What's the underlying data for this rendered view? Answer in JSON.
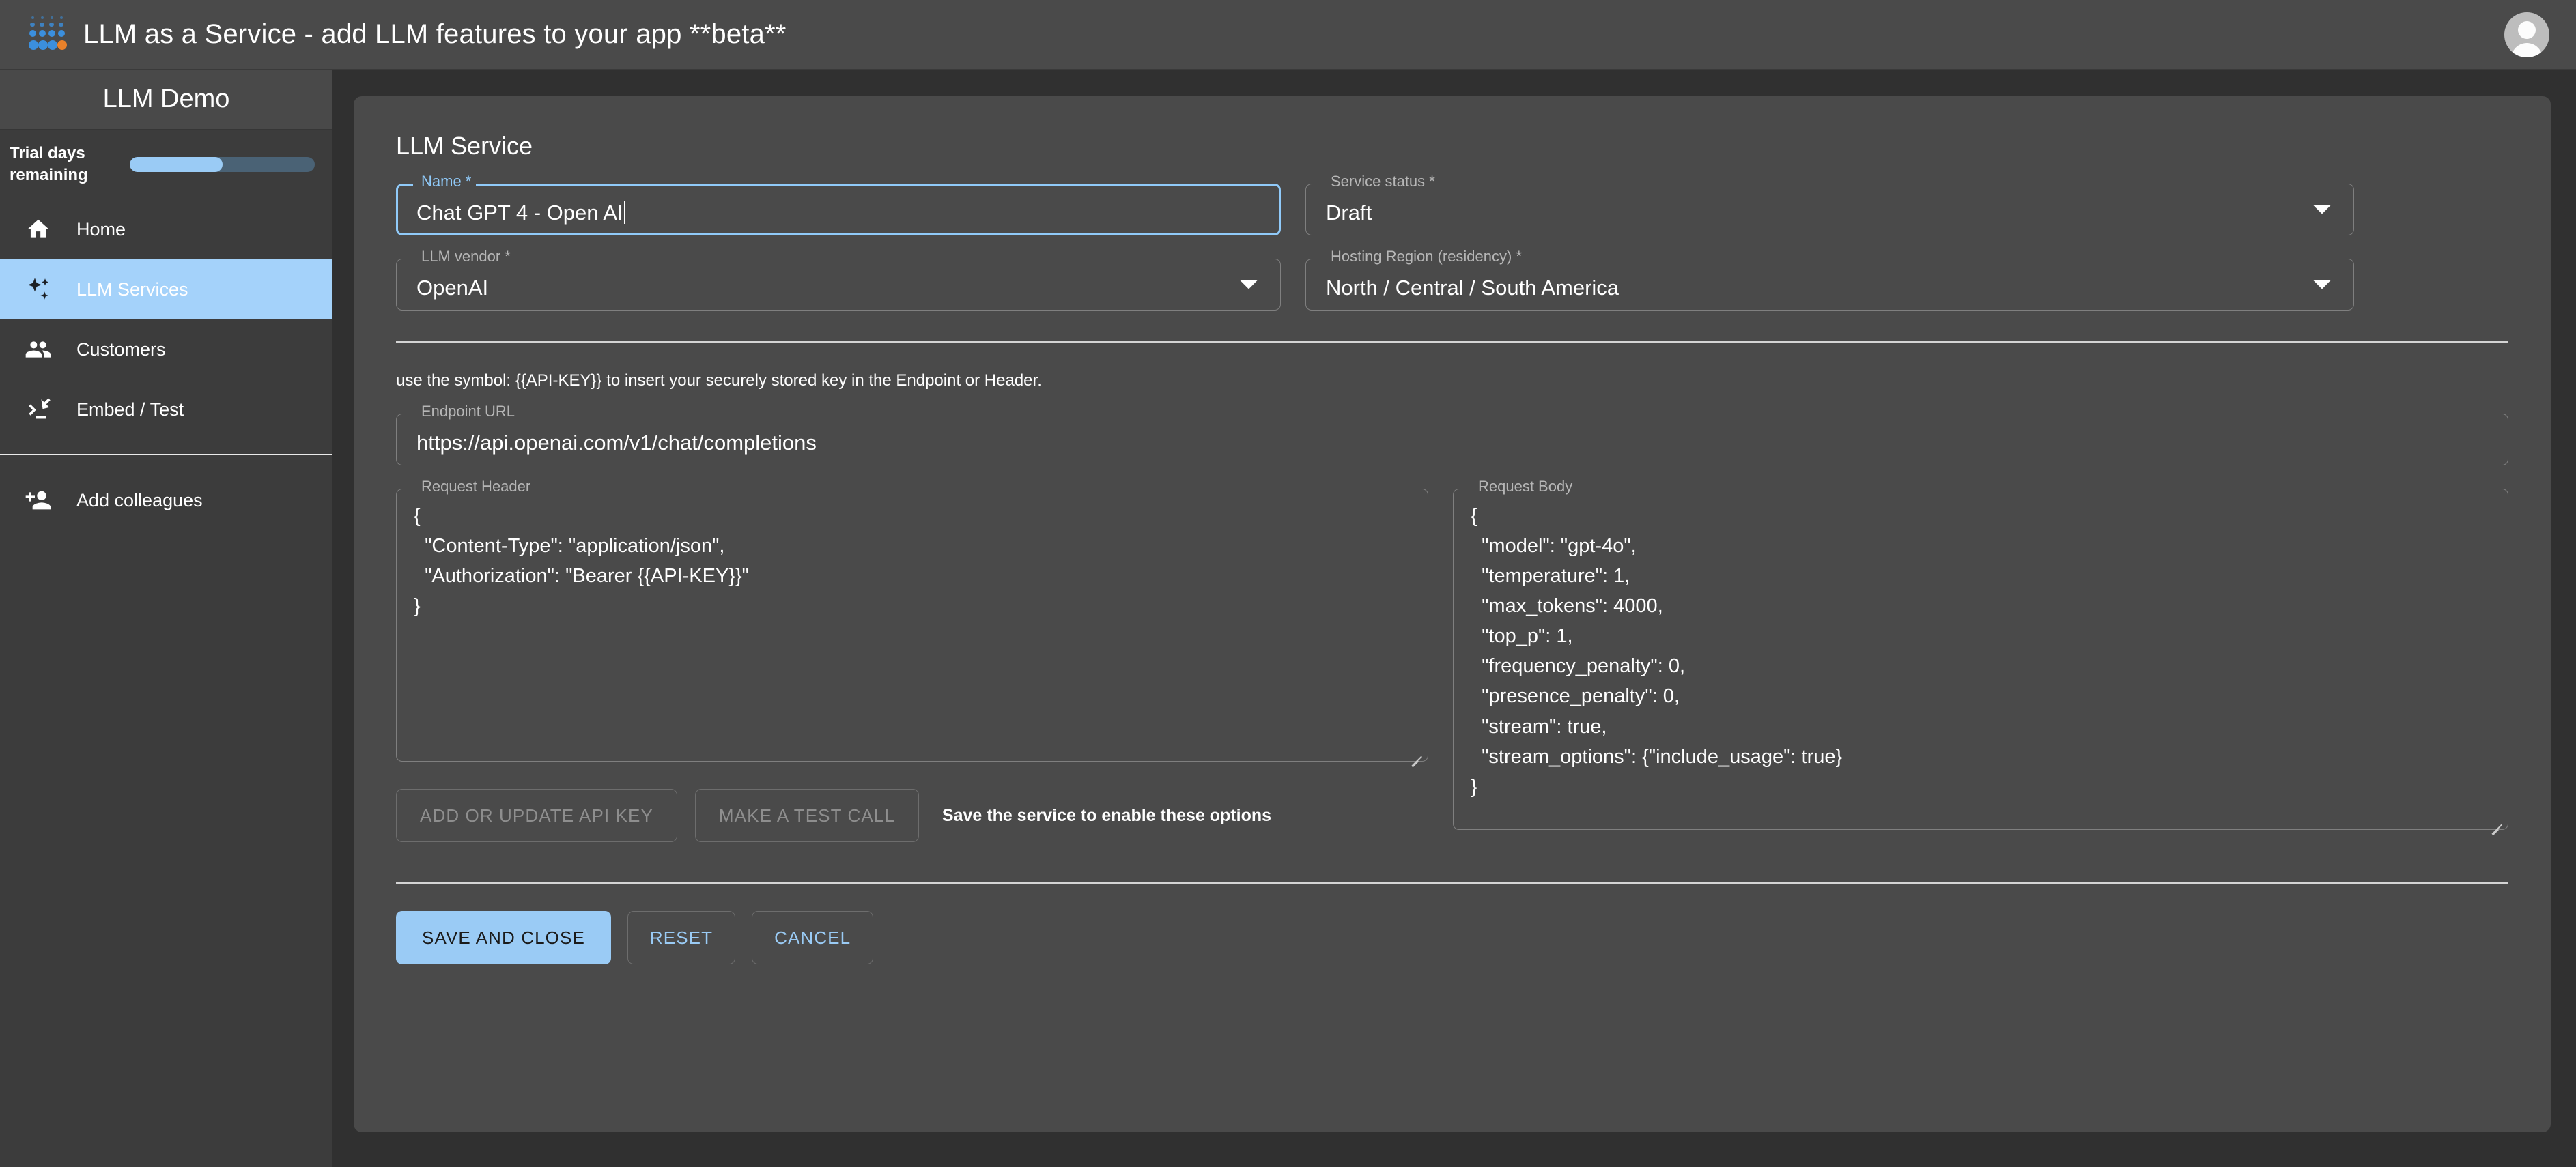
{
  "topbar": {
    "title": "LLM as a Service - add LLM features to your app **beta**",
    "logo_icon": "dot-pyramid-logo",
    "avatar_icon": "user-avatar-icon"
  },
  "sidebar": {
    "heading": "LLM Demo",
    "trial": {
      "label": "Trial days remaining",
      "percent": 50
    },
    "items": [
      {
        "label": "Home",
        "icon": "home-icon",
        "active": false
      },
      {
        "label": "LLM Services",
        "icon": "auto-awesome-sparkle-icon",
        "active": true
      },
      {
        "label": "Customers",
        "icon": "people-group-icon",
        "active": false
      },
      {
        "label": "Embed / Test",
        "icon": "integration-instructions-icon",
        "active": false
      },
      {
        "label": "Add colleagues",
        "icon": "person-add-icon",
        "active": false
      }
    ]
  },
  "main": {
    "title": "LLM Service",
    "fields": {
      "name": {
        "label": "Name *",
        "value": "Chat GPT 4 - Open AI"
      },
      "service_status": {
        "label": "Service status *",
        "value": "Draft"
      },
      "llm_vendor": {
        "label": "LLM vendor *",
        "value": "OpenAI"
      },
      "hosting_region": {
        "label": "Hosting Region (residency) *",
        "value": "North / Central / South America"
      },
      "endpoint_url": {
        "label": "Endpoint URL",
        "value": "https://api.openai.com/v1/chat/completions"
      },
      "request_header": {
        "label": "Request Header",
        "value": "{\n  \"Content-Type\": \"application/json\",\n  \"Authorization\": \"Bearer {{API-KEY}}\"\n}"
      },
      "request_body": {
        "label": "Request Body",
        "value": "{\n  \"model\": \"gpt-4o\",\n  \"temperature\": 1,\n  \"max_tokens\": 4000,\n  \"top_p\": 1,\n  \"frequency_penalty\": 0,\n  \"presence_penalty\": 0,\n  \"stream\": true,\n  \"stream_options\": {\"include_usage\": true}\n}"
      }
    },
    "hint": "use the symbol: {{API-KEY}} to insert your securely stored key in the Endpoint or Header.",
    "buttons": {
      "add_api_key": "ADD OR UPDATE API KEY",
      "make_test_call": "MAKE A TEST CALL",
      "disabled_note": "Save the service to enable these options",
      "save_and_close": "SAVE AND CLOSE",
      "reset": "RESET",
      "cancel": "CANCEL"
    }
  },
  "colors": {
    "accent": "#9acbf5",
    "sidebar_active_bg": "#a4d2fa",
    "panel_bg": "#4a4a4a",
    "page_bg": "#303030",
    "logo_blue": "#3b8fdd",
    "logo_orange": "#e8812a"
  }
}
